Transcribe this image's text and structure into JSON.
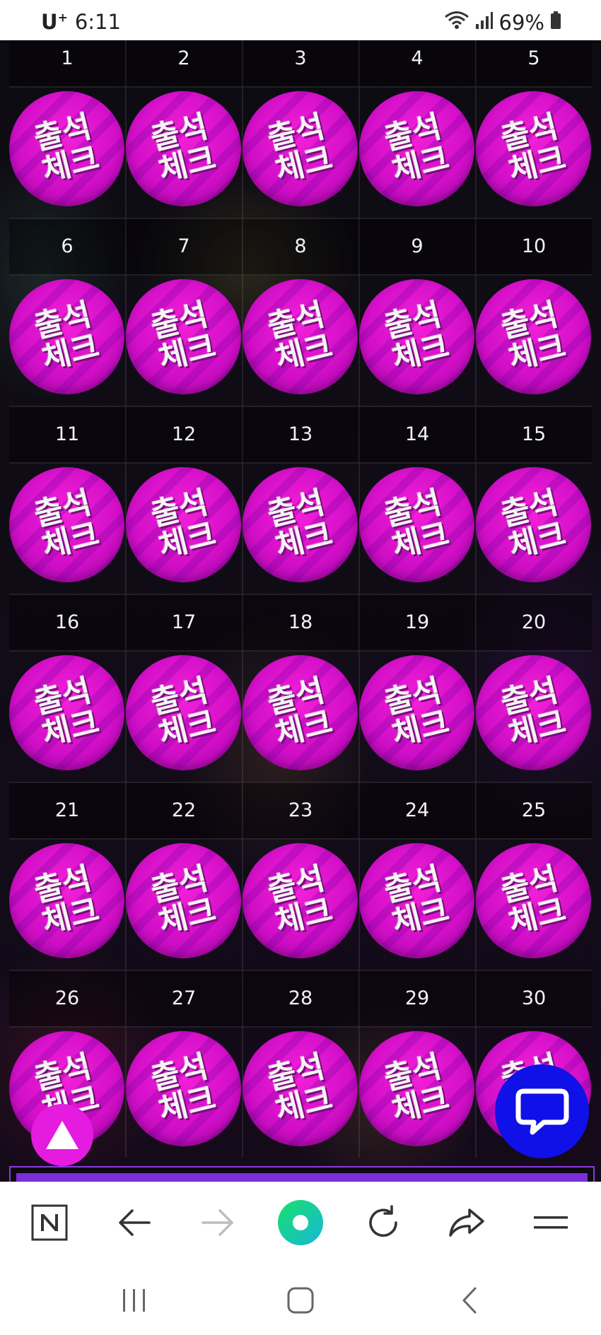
{
  "status_bar": {
    "carrier": "U",
    "carrier_plus": "+",
    "time": "6:11",
    "battery": "69%"
  },
  "calendar": {
    "stamp_label": "출석\n체크",
    "weeks": [
      [
        "1",
        "2",
        "3",
        "4",
        "5"
      ],
      [
        "6",
        "7",
        "8",
        "9",
        "10"
      ],
      [
        "11",
        "12",
        "13",
        "14",
        "15"
      ],
      [
        "16",
        "17",
        "18",
        "19",
        "20"
      ],
      [
        "21",
        "22",
        "23",
        "24",
        "25"
      ],
      [
        "26",
        "27",
        "28",
        "29",
        "30"
      ]
    ]
  },
  "floating": {
    "scroll_top_icon": "triangle-up-icon",
    "chat_icon": "chat-bubble-icon",
    "scroll_top_color": "#e51be0",
    "chat_color": "#1010e8"
  },
  "browser_toolbar": {
    "icons": [
      "naver-n-icon",
      "back-arrow-icon",
      "forward-arrow-icon",
      "green-dot-icon",
      "reload-icon",
      "share-icon",
      "menu-icon"
    ],
    "naver_label": "N",
    "accent_color": "#19d3a0"
  },
  "system_nav": {
    "icons": [
      "recents-icon",
      "home-icon",
      "back-icon"
    ]
  },
  "colors": {
    "stamp": "#d30fc8",
    "purple_bar": "#7b2ed8"
  }
}
